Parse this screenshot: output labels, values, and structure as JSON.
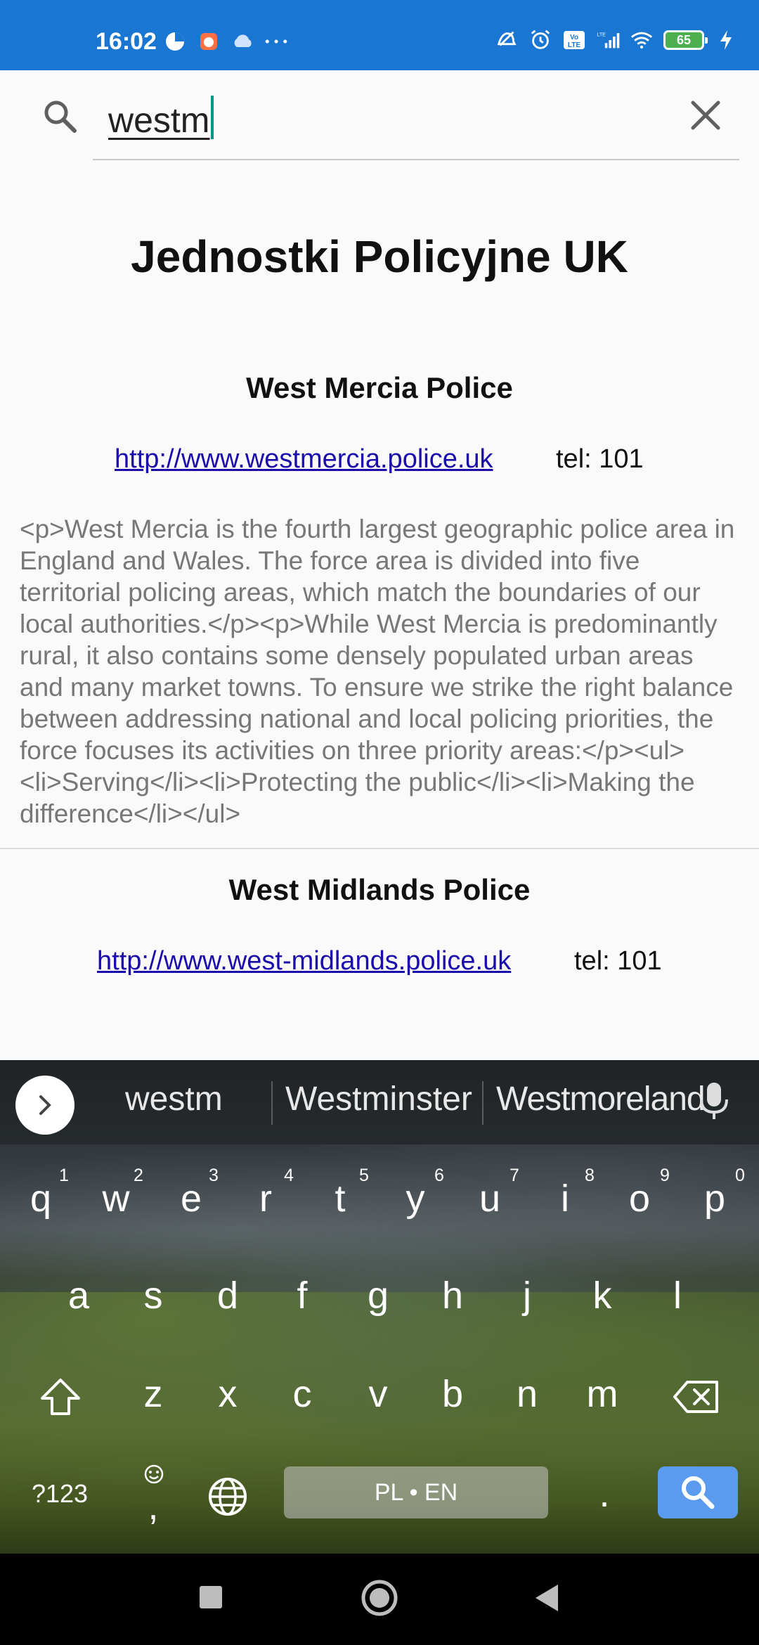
{
  "status_bar": {
    "time": "16:02",
    "battery": "65",
    "network": "LTE"
  },
  "search": {
    "value": "westm",
    "placeholder": ""
  },
  "page": {
    "title": "Jednostki Policyjne UK"
  },
  "results": [
    {
      "name": "West Mercia Police",
      "url": "http://www.westmercia.police.uk",
      "tel": "tel: 101",
      "description": "<p>West Mercia is the fourth largest geographic police area in England and Wales. The force area is divided into five territorial policing areas, which match the boundaries of our local authorities.</p><p>While West Mercia is predominantly rural, it also contains some densely populated urban areas and many market towns. To ensure we strike the right balance between addressing national and local policing priorities, the force focuses its activities on three priority areas:</p><ul><li>Serving</li><li>Protecting the public</li><li>Making the difference</li></ul>"
    },
    {
      "name": "West Midlands Police",
      "url": "http://www.west-midlands.police.uk",
      "tel": "tel: 101"
    }
  ],
  "keyboard": {
    "suggestions": [
      "westm",
      "Westminster",
      "Westmoreland"
    ],
    "row1": [
      "q",
      "w",
      "e",
      "r",
      "t",
      "y",
      "u",
      "i",
      "o",
      "p"
    ],
    "row1_numbers": [
      "1",
      "2",
      "3",
      "4",
      "5",
      "6",
      "7",
      "8",
      "9",
      "0"
    ],
    "row2": [
      "a",
      "s",
      "d",
      "f",
      "g",
      "h",
      "j",
      "k",
      "l"
    ],
    "row3": [
      "z",
      "x",
      "c",
      "v",
      "b",
      "n",
      "m"
    ],
    "symbols_key": "?123",
    "comma_key": ",",
    "period_key": ".",
    "space_label": "PL • EN"
  },
  "colors": {
    "status_bar": "#1976d2",
    "link": "#1a0dab",
    "cursor": "#009688",
    "search_key": "#5a9bef"
  }
}
